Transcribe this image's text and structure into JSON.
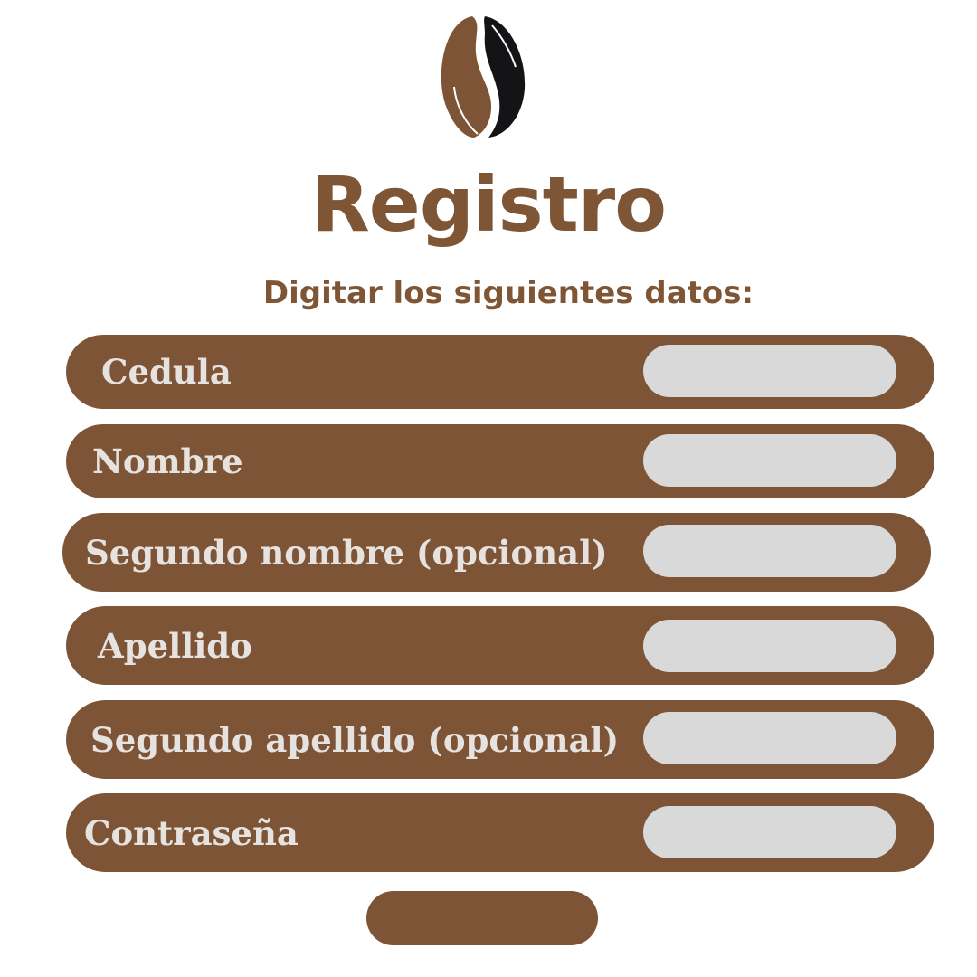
{
  "header": {
    "title": "Registro",
    "subtitle": "Digitar los siguientes datos:"
  },
  "fields": [
    {
      "label": "Cedula",
      "value": ""
    },
    {
      "label": "Nombre",
      "value": ""
    },
    {
      "label": "Segundo nombre (opcional)",
      "value": ""
    },
    {
      "label": "Apellido",
      "value": ""
    },
    {
      "label": "Segundo apellido (opcional)",
      "value": ""
    },
    {
      "label": "Contraseña",
      "value": ""
    }
  ],
  "colors": {
    "brand_brown": "#7d5536",
    "bean_dark": "#141315",
    "input_gray": "#d9d9d9",
    "label_light": "#e6e2df"
  },
  "icons": {
    "logo": "coffee-bean-icon"
  }
}
